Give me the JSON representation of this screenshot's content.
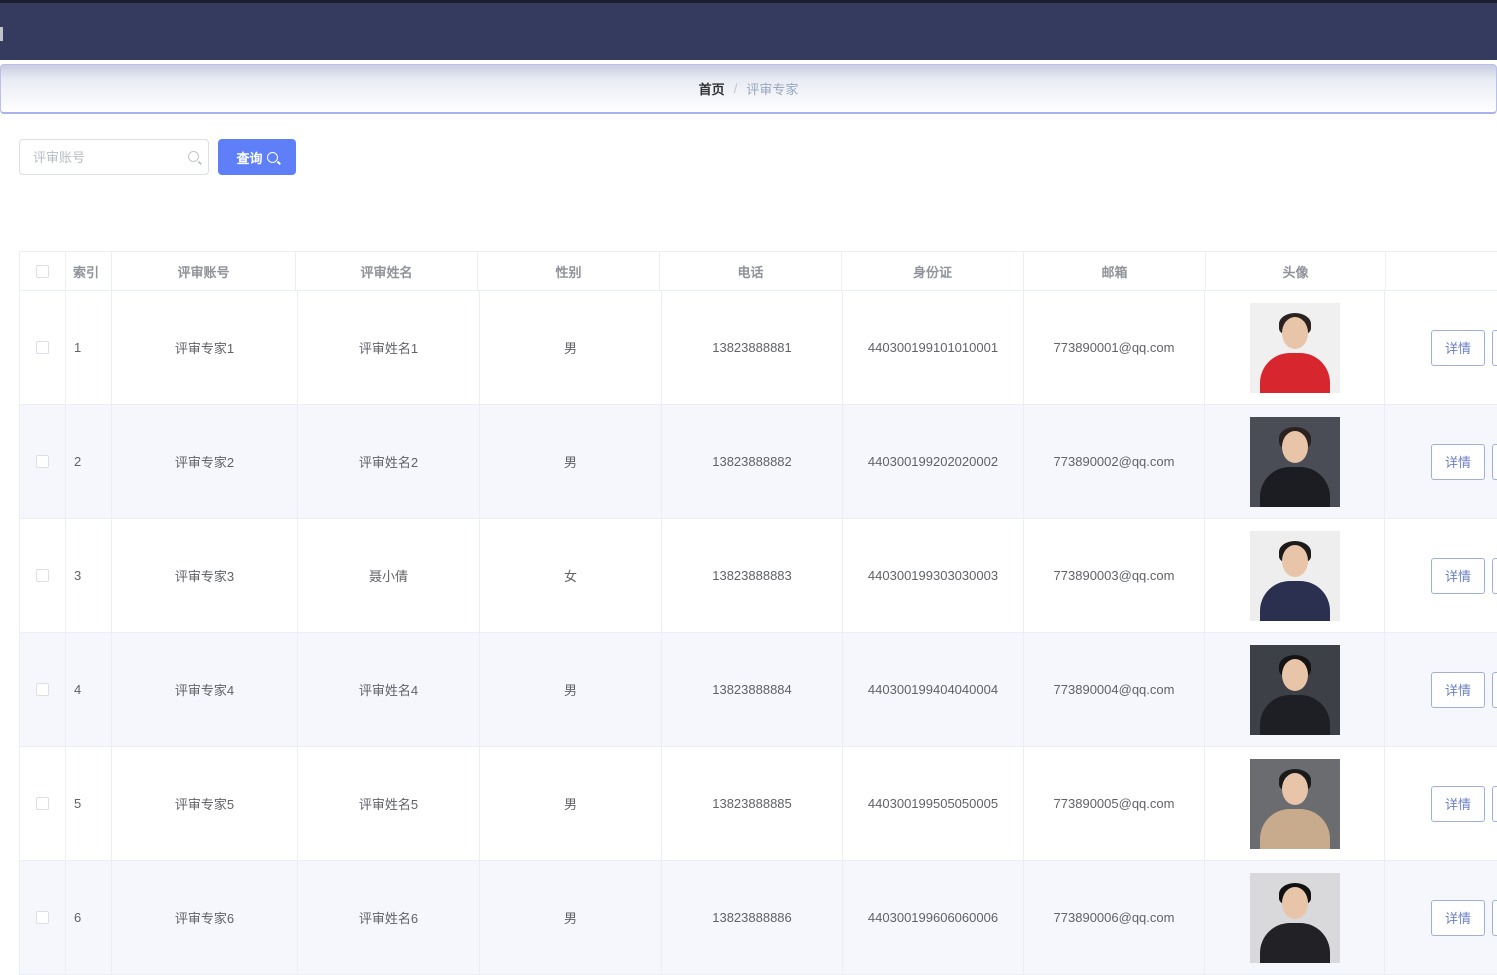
{
  "breadcrumb": {
    "home": "首页",
    "separator": "/",
    "current": "评审专家"
  },
  "search": {
    "placeholder": "评审账号",
    "value": ""
  },
  "query_button": {
    "label": "查询",
    "icon": "search-icon"
  },
  "table": {
    "headers": [
      "",
      "索引",
      "评审账号",
      "评审姓名",
      "性别",
      "电话",
      "身份证",
      "邮箱",
      "头像",
      ""
    ],
    "action_label": "详情",
    "rows": [
      {
        "index": "1",
        "account": "评审专家1",
        "name": "评审姓名1",
        "gender": "男",
        "phone": "13823888881",
        "id_card": "440300199101010001",
        "email": "773890001@qq.com",
        "avatar": {
          "bg": "#f0f0f0",
          "body": "#d8262e",
          "hair": "#2a2220"
        }
      },
      {
        "index": "2",
        "account": "评审专家2",
        "name": "评审姓名2",
        "gender": "男",
        "phone": "13823888882",
        "id_card": "440300199202020002",
        "email": "773890002@qq.com",
        "avatar": {
          "bg": "#4a4d55",
          "body": "#1c1d22",
          "hair": "#2a2220"
        }
      },
      {
        "index": "3",
        "account": "评审专家3",
        "name": "聂小倩",
        "gender": "女",
        "phone": "13823888883",
        "id_card": "440300199303030003",
        "email": "773890003@qq.com",
        "avatar": {
          "bg": "#eeeeee",
          "body": "#2b3050",
          "hair": "#1e1a18"
        }
      },
      {
        "index": "4",
        "account": "评审专家4",
        "name": "评审姓名4",
        "gender": "男",
        "phone": "13823888884",
        "id_card": "440300199404040004",
        "email": "773890004@qq.com",
        "avatar": {
          "bg": "#3d4046",
          "body": "#1d1f24",
          "hair": "#141414"
        }
      },
      {
        "index": "5",
        "account": "评审专家5",
        "name": "评审姓名5",
        "gender": "男",
        "phone": "13823888885",
        "id_card": "440300199505050005",
        "email": "773890005@qq.com",
        "avatar": {
          "bg": "#6a6c70",
          "body": "#c8ab8c",
          "hair": "#1a1a1a"
        }
      },
      {
        "index": "6",
        "account": "评审专家6",
        "name": "评审姓名6",
        "gender": "男",
        "phone": "13823888886",
        "id_card": "440300199606060006",
        "email": "773890006@qq.com",
        "avatar": {
          "bg": "#d9d9dc",
          "body": "#222226",
          "hair": "#111111"
        }
      }
    ]
  },
  "colors": {
    "topbar": "#343b5e",
    "primary": "#5e7ff7"
  }
}
